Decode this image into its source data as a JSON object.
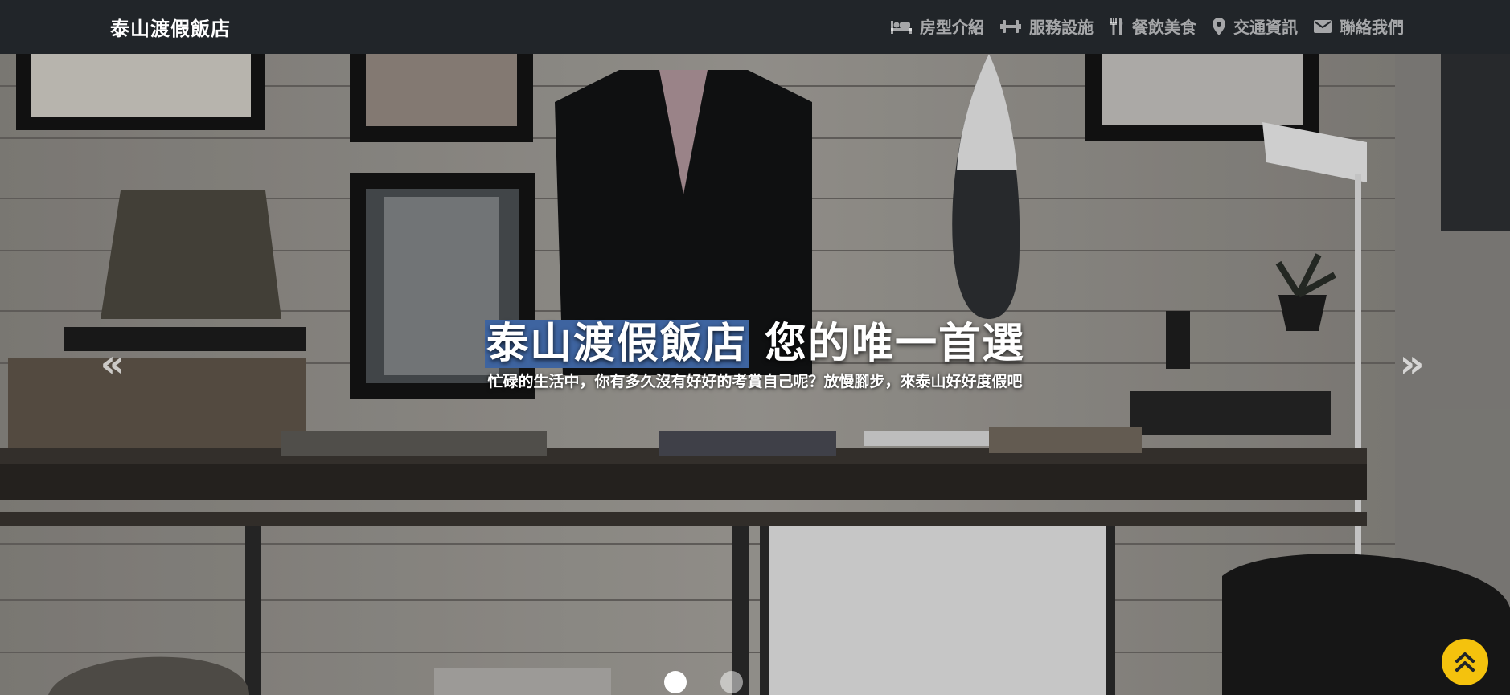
{
  "brand": "泰山渡假飯店",
  "nav": [
    {
      "label": "房型介紹",
      "icon": "bed-icon"
    },
    {
      "label": "服務設施",
      "icon": "dumbbell-icon"
    },
    {
      "label": "餐飲美食",
      "icon": "utensils-icon"
    },
    {
      "label": "交通資訊",
      "icon": "map-marker-icon"
    },
    {
      "label": "聯絡我們",
      "icon": "envelope-icon"
    }
  ],
  "hero": {
    "title_highlight": "泰山渡假飯店",
    "title_rest": " 您的唯一首選",
    "subtitle": "忙碌的生活中，你有多久沒有好好的考賞自己呢？放慢腳步，來泰山好好度假吧",
    "prev_symbol": "«",
    "next_symbol": "»",
    "slides_count": 2,
    "active_slide": 1
  },
  "back_to_top": {
    "icon": "double-chevron-up-icon",
    "color": "#f4c20d"
  },
  "colors": {
    "navbar_bg": "#212529",
    "highlight": "#3e64a0"
  }
}
